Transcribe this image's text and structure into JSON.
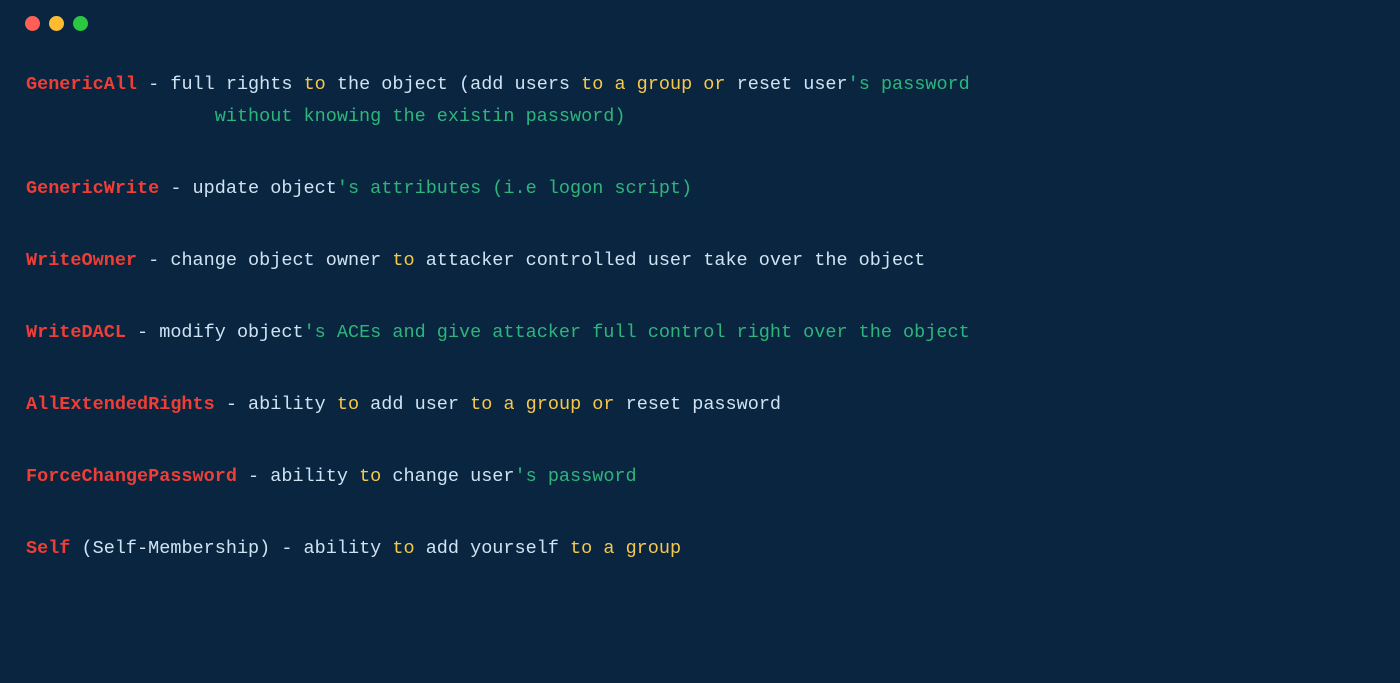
{
  "window": {
    "traffic_lights": [
      "red",
      "yellow",
      "green"
    ]
  },
  "entries": [
    {
      "name": "GenericAll",
      "tokens": [
        {
          "c": "t-keyword",
          "t": "GenericAll"
        },
        {
          "c": "t-default",
          "t": " - full rights "
        },
        {
          "c": "t-blue",
          "t": "to"
        },
        {
          "c": "t-default",
          "t": " the object (add users "
        },
        {
          "c": "t-blue",
          "t": "to"
        },
        {
          "c": "t-default",
          "t": " "
        },
        {
          "c": "t-blue",
          "t": "a"
        },
        {
          "c": "t-default",
          "t": " "
        },
        {
          "c": "t-blue",
          "t": "group"
        },
        {
          "c": "t-default",
          "t": " "
        },
        {
          "c": "t-blue",
          "t": "or"
        },
        {
          "c": "t-default",
          "t": " reset user"
        },
        {
          "c": "t-green",
          "t": "'s password"
        }
      ],
      "tokens2": [
        {
          "c": "t-default",
          "t": "                 "
        },
        {
          "c": "t-green",
          "t": "without knowing the existin password)"
        }
      ]
    },
    {
      "name": "GenericWrite",
      "tokens": [
        {
          "c": "t-keyword",
          "t": "GenericWrite"
        },
        {
          "c": "t-default",
          "t": " - update object"
        },
        {
          "c": "t-green",
          "t": "'s attributes (i.e logon script)"
        }
      ]
    },
    {
      "name": "WriteOwner",
      "tokens": [
        {
          "c": "t-keyword",
          "t": "WriteOwner"
        },
        {
          "c": "t-default",
          "t": " - change object owner "
        },
        {
          "c": "t-blue",
          "t": "to"
        },
        {
          "c": "t-default",
          "t": " attacker controlled user take over the object"
        }
      ]
    },
    {
      "name": "WriteDACL",
      "tokens": [
        {
          "c": "t-keyword",
          "t": "WriteDACL"
        },
        {
          "c": "t-default",
          "t": " - modify object"
        },
        {
          "c": "t-green",
          "t": "'s ACEs and give attacker full control right over the object"
        }
      ]
    },
    {
      "name": "AllExtendedRights",
      "tokens": [
        {
          "c": "t-keyword",
          "t": "AllExtendedRights"
        },
        {
          "c": "t-default",
          "t": " - ability "
        },
        {
          "c": "t-blue",
          "t": "to"
        },
        {
          "c": "t-default",
          "t": " add user "
        },
        {
          "c": "t-blue",
          "t": "to"
        },
        {
          "c": "t-default",
          "t": " "
        },
        {
          "c": "t-blue",
          "t": "a"
        },
        {
          "c": "t-default",
          "t": " "
        },
        {
          "c": "t-blue",
          "t": "group"
        },
        {
          "c": "t-default",
          "t": " "
        },
        {
          "c": "t-blue",
          "t": "or"
        },
        {
          "c": "t-default",
          "t": " reset password"
        }
      ]
    },
    {
      "name": "ForceChangePassword",
      "tokens": [
        {
          "c": "t-keyword",
          "t": "ForceChangePassword"
        },
        {
          "c": "t-default",
          "t": " - ability "
        },
        {
          "c": "t-blue",
          "t": "to"
        },
        {
          "c": "t-default",
          "t": " change user"
        },
        {
          "c": "t-green",
          "t": "'s password"
        }
      ]
    },
    {
      "name": "Self",
      "tokens": [
        {
          "c": "t-keyword",
          "t": "Self"
        },
        {
          "c": "t-default",
          "t": " (Self-Membership) - ability "
        },
        {
          "c": "t-blue",
          "t": "to"
        },
        {
          "c": "t-default",
          "t": " add yourself "
        },
        {
          "c": "t-blue",
          "t": "to"
        },
        {
          "c": "t-default",
          "t": " "
        },
        {
          "c": "t-blue",
          "t": "a"
        },
        {
          "c": "t-default",
          "t": " "
        },
        {
          "c": "t-blue",
          "t": "group"
        }
      ]
    }
  ]
}
